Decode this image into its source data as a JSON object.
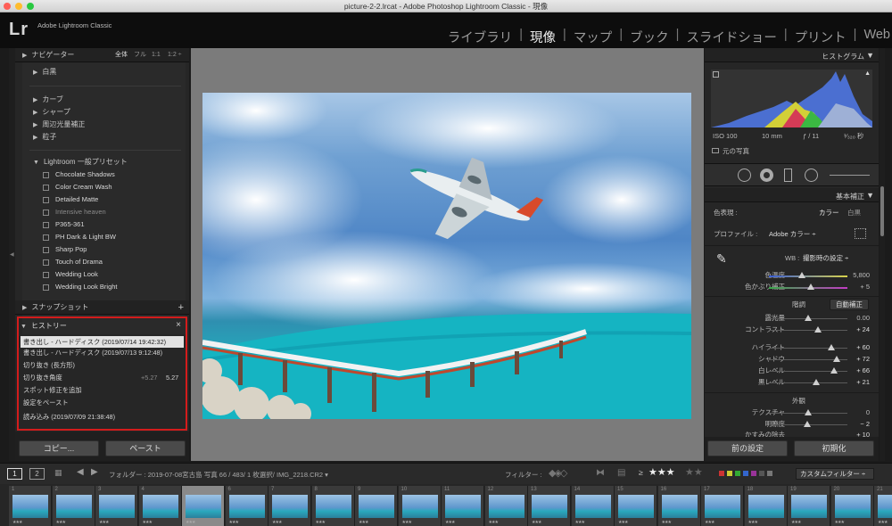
{
  "window": {
    "title": "picture-2-2.lrcat - Adobe Photoshop Lightroom Classic - 現像"
  },
  "identity": {
    "logo": "Lr",
    "app_name": "Adobe Lightroom Classic"
  },
  "modules": {
    "items": [
      "ライブラリ",
      "現像",
      "マップ",
      "ブック",
      "スライドショー",
      "プリント",
      "Web"
    ],
    "active": "現像"
  },
  "navigator": {
    "title": "ナビゲーター",
    "zoom": [
      "全体",
      "フル",
      "1:1",
      "1:2 ÷"
    ]
  },
  "presets": {
    "bw": "白黒",
    "curve": "カーブ",
    "sharp": "シャープ",
    "vignette": "周辺光量補正",
    "grain": "粒子",
    "group": "Lightroom 一般プリセット",
    "items": [
      "Chocolate Shadows",
      "Color Cream Wash",
      "Detailed Matte",
      "Intensive heaven",
      "P365-361",
      "PH Dark & Light BW",
      "Sharp Pop",
      "Touch of Drama",
      "Wedding Look",
      "Wedding Look Bright"
    ]
  },
  "snapshot": {
    "title": "スナップショット",
    "add": "+"
  },
  "history": {
    "title": "ヒストリー",
    "close": "×",
    "items": [
      {
        "label": "書き出し - ハードディスク (2019/07/14 19:42:32)",
        "before": "",
        "after": ""
      },
      {
        "label": "書き出し - ハードディスク (2019/07/13 9:12:48)",
        "before": "",
        "after": ""
      },
      {
        "label": "切り抜き (長方形)",
        "before": "",
        "after": ""
      },
      {
        "label": "切り抜き角度",
        "before": "+5.27",
        "after": "5.27"
      },
      {
        "label": "スポット修正を追加",
        "before": "",
        "after": ""
      },
      {
        "label": "設定をペースト",
        "before": "",
        "after": ""
      },
      {
        "label": "読み込み (2019/07/09 21:38:48)",
        "before": "",
        "after": ""
      }
    ]
  },
  "left_buttons": {
    "copy": "コピー...",
    "paste": "ペースト"
  },
  "histogram": {
    "title": "ヒストグラム",
    "iso": "ISO 100",
    "focal": "10 mm",
    "fstop": "ƒ / 11",
    "shutter": "¹⁄₃₂₀ 秒",
    "original": "元の写真"
  },
  "basic": {
    "title": "基本補正",
    "treatment_label": "色表現 :",
    "color": "カラー",
    "bw": "白黒",
    "profile_label": "プロファイル :",
    "profile": "Adobe カラー ÷",
    "wb_label": "WB :",
    "wb": "撮影時の設定 ÷",
    "temp_label": "色温度",
    "temp": "5,800",
    "temp_pos": 0.42,
    "tint_label": "色かぶり補正",
    "tint": "+ 5",
    "tint_pos": 0.53,
    "tone": "階調",
    "auto": "自動補正",
    "exposure_label": "露光量",
    "exposure": "0.00",
    "exposure_pos": 0.5,
    "contrast_label": "コントラスト",
    "contrast": "+ 24",
    "contrast_pos": 0.62,
    "highlights_label": "ハイライト",
    "highlights": "+ 60",
    "highlights_pos": 0.8,
    "shadows_label": "シャドウ",
    "shadows": "+ 72",
    "shadows_pos": 0.86,
    "whites_label": "白レベル",
    "whites": "+ 66",
    "whites_pos": 0.83,
    "blacks_label": "黒レベル",
    "blacks": "+ 21",
    "blacks_pos": 0.6,
    "presence": "外観",
    "texture_label": "テクスチャ",
    "texture": "0",
    "texture_pos": 0.5,
    "clarity_label": "明瞭度",
    "clarity": "− 2",
    "clarity_pos": 0.49,
    "dehaze_label": "かすみの除去",
    "dehaze": "+ 10",
    "dehaze_pos": 0.55
  },
  "right_buttons": {
    "previous": "前の設定",
    "reset": "初期化"
  },
  "filmbar": {
    "view1": "1",
    "view2": "2",
    "path": "フォルダー : 2019-07-08宮古島  写真 66 / 483/ 1 枚選択/ IMG_2218.CR2 ▾",
    "filter_label": "フィルター :",
    "stars": "★★★",
    "stars_off": "★★",
    "rating_op": "≥",
    "custom": "カスタムフィルター ÷"
  },
  "filmstrip": {
    "numbers": [
      "1",
      "2",
      "3",
      "4",
      "5",
      "6",
      "7",
      "8",
      "9",
      "10",
      "11",
      "12",
      "13",
      "14",
      "15",
      "16",
      "17",
      "18",
      "19",
      "20",
      "21"
    ],
    "ratings": [
      "★★★",
      "★★★",
      "★★★",
      "★★★",
      "★★★",
      "★★★",
      "★★★",
      "★★★",
      "★★★",
      "★★★",
      "★★★",
      "★★★",
      "★★★",
      "★★★",
      "★★★",
      "★★★",
      "★★★",
      "★★★",
      "★★★",
      "★★★",
      "★★★"
    ]
  }
}
